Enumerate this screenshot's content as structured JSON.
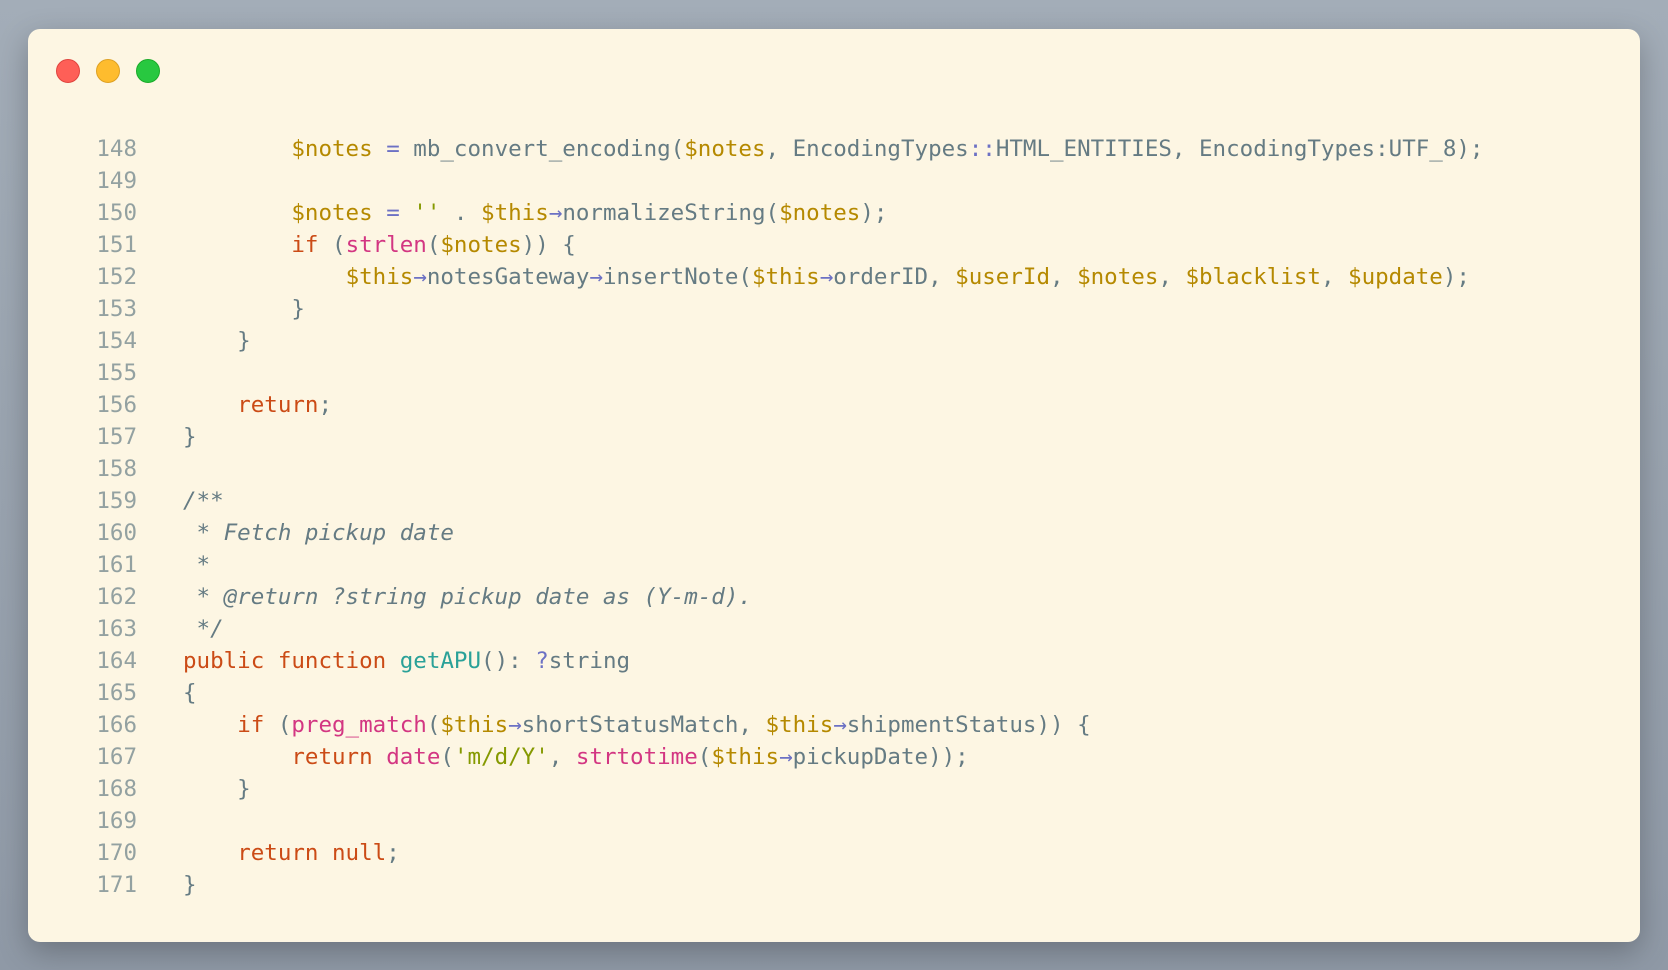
{
  "window": {
    "controls": [
      "close",
      "minimize",
      "maximize"
    ],
    "colors": {
      "background": "#fdf6e3",
      "close": "#fe5f57",
      "minimize": "#febc2e",
      "maximize": "#28c840"
    }
  },
  "syntax_colors": {
    "var": "#b58900",
    "kw": "#cb4b16",
    "fn": "#d33682",
    "decl": "#2aa198",
    "op": "#6c71c4",
    "str": "#859900",
    "cm": "#657b83",
    "plain": "#657b83"
  },
  "code": {
    "lines": [
      {
        "number": "148",
        "tokens": [
          [
            "plain",
            "        "
          ],
          [
            "var",
            "$notes"
          ],
          [
            "plain",
            " "
          ],
          [
            "op",
            "="
          ],
          [
            "plain",
            " mb_convert_encoding("
          ],
          [
            "var",
            "$notes"
          ],
          [
            "plain",
            ", EncodingTypes"
          ],
          [
            "op",
            "::"
          ],
          [
            "plain",
            "HTML_ENTITIES, EncodingTypes:UTF_8);"
          ]
        ]
      },
      {
        "number": "149",
        "tokens": []
      },
      {
        "number": "150",
        "tokens": [
          [
            "plain",
            "        "
          ],
          [
            "var",
            "$notes"
          ],
          [
            "plain",
            " "
          ],
          [
            "op",
            "="
          ],
          [
            "plain",
            " "
          ],
          [
            "str",
            "''"
          ],
          [
            "plain",
            " . "
          ],
          [
            "var",
            "$this"
          ],
          [
            "op",
            "→"
          ],
          [
            "plain",
            "normalizeString("
          ],
          [
            "var",
            "$notes"
          ],
          [
            "plain",
            ");"
          ]
        ]
      },
      {
        "number": "151",
        "tokens": [
          [
            "plain",
            "        "
          ],
          [
            "kw",
            "if"
          ],
          [
            "plain",
            " ("
          ],
          [
            "fn",
            "strlen"
          ],
          [
            "plain",
            "("
          ],
          [
            "var",
            "$notes"
          ],
          [
            "plain",
            ")) {"
          ]
        ]
      },
      {
        "number": "152",
        "tokens": [
          [
            "plain",
            "            "
          ],
          [
            "var",
            "$this"
          ],
          [
            "op",
            "→"
          ],
          [
            "plain",
            "notesGateway"
          ],
          [
            "op",
            "→"
          ],
          [
            "plain",
            "insertNote("
          ],
          [
            "var",
            "$this"
          ],
          [
            "op",
            "→"
          ],
          [
            "plain",
            "orderID, "
          ],
          [
            "var",
            "$userId"
          ],
          [
            "plain",
            ", "
          ],
          [
            "var",
            "$notes"
          ],
          [
            "plain",
            ", "
          ],
          [
            "var",
            "$blacklist"
          ],
          [
            "plain",
            ", "
          ],
          [
            "var",
            "$update"
          ],
          [
            "plain",
            ");"
          ]
        ]
      },
      {
        "number": "153",
        "tokens": [
          [
            "plain",
            "        }"
          ]
        ]
      },
      {
        "number": "154",
        "tokens": [
          [
            "plain",
            "    }"
          ]
        ]
      },
      {
        "number": "155",
        "tokens": []
      },
      {
        "number": "156",
        "tokens": [
          [
            "plain",
            "    "
          ],
          [
            "kw",
            "return"
          ],
          [
            "plain",
            ";"
          ]
        ]
      },
      {
        "number": "157",
        "tokens": [
          [
            "plain",
            "}"
          ]
        ]
      },
      {
        "number": "158",
        "tokens": []
      },
      {
        "number": "159",
        "tokens": [
          [
            "cm",
            "/**"
          ]
        ]
      },
      {
        "number": "160",
        "tokens": [
          [
            "cm",
            " * Fetch pickup date"
          ]
        ]
      },
      {
        "number": "161",
        "tokens": [
          [
            "cm",
            " *"
          ]
        ]
      },
      {
        "number": "162",
        "tokens": [
          [
            "cm",
            " * @return ?string pickup date as (Y-m-d)."
          ]
        ]
      },
      {
        "number": "163",
        "tokens": [
          [
            "cm",
            " */"
          ]
        ]
      },
      {
        "number": "164",
        "tokens": [
          [
            "kw",
            "public"
          ],
          [
            "plain",
            " "
          ],
          [
            "kw",
            "function"
          ],
          [
            "plain",
            " "
          ],
          [
            "decl",
            "getAPU"
          ],
          [
            "plain",
            "(): "
          ],
          [
            "op",
            "?"
          ],
          [
            "plain",
            "string"
          ]
        ]
      },
      {
        "number": "165",
        "tokens": [
          [
            "plain",
            "{"
          ]
        ]
      },
      {
        "number": "166",
        "tokens": [
          [
            "plain",
            "    "
          ],
          [
            "kw",
            "if"
          ],
          [
            "plain",
            " ("
          ],
          [
            "fn",
            "preg_match"
          ],
          [
            "plain",
            "("
          ],
          [
            "var",
            "$this"
          ],
          [
            "op",
            "→"
          ],
          [
            "plain",
            "shortStatusMatch, "
          ],
          [
            "var",
            "$this"
          ],
          [
            "op",
            "→"
          ],
          [
            "plain",
            "shipmentStatus)) {"
          ]
        ]
      },
      {
        "number": "167",
        "tokens": [
          [
            "plain",
            "        "
          ],
          [
            "kw",
            "return"
          ],
          [
            "plain",
            " "
          ],
          [
            "fn",
            "date"
          ],
          [
            "plain",
            "("
          ],
          [
            "str",
            "'m/d/Y'"
          ],
          [
            "plain",
            ", "
          ],
          [
            "fn",
            "strtotime"
          ],
          [
            "plain",
            "("
          ],
          [
            "var",
            "$this"
          ],
          [
            "op",
            "→"
          ],
          [
            "plain",
            "pickupDate));"
          ]
        ]
      },
      {
        "number": "168",
        "tokens": [
          [
            "plain",
            "    }"
          ]
        ]
      },
      {
        "number": "169",
        "tokens": []
      },
      {
        "number": "170",
        "tokens": [
          [
            "plain",
            "    "
          ],
          [
            "kw",
            "return"
          ],
          [
            "plain",
            " "
          ],
          [
            "kw",
            "null"
          ],
          [
            "plain",
            ";"
          ]
        ]
      },
      {
        "number": "171",
        "tokens": [
          [
            "plain",
            "}"
          ]
        ]
      }
    ]
  }
}
